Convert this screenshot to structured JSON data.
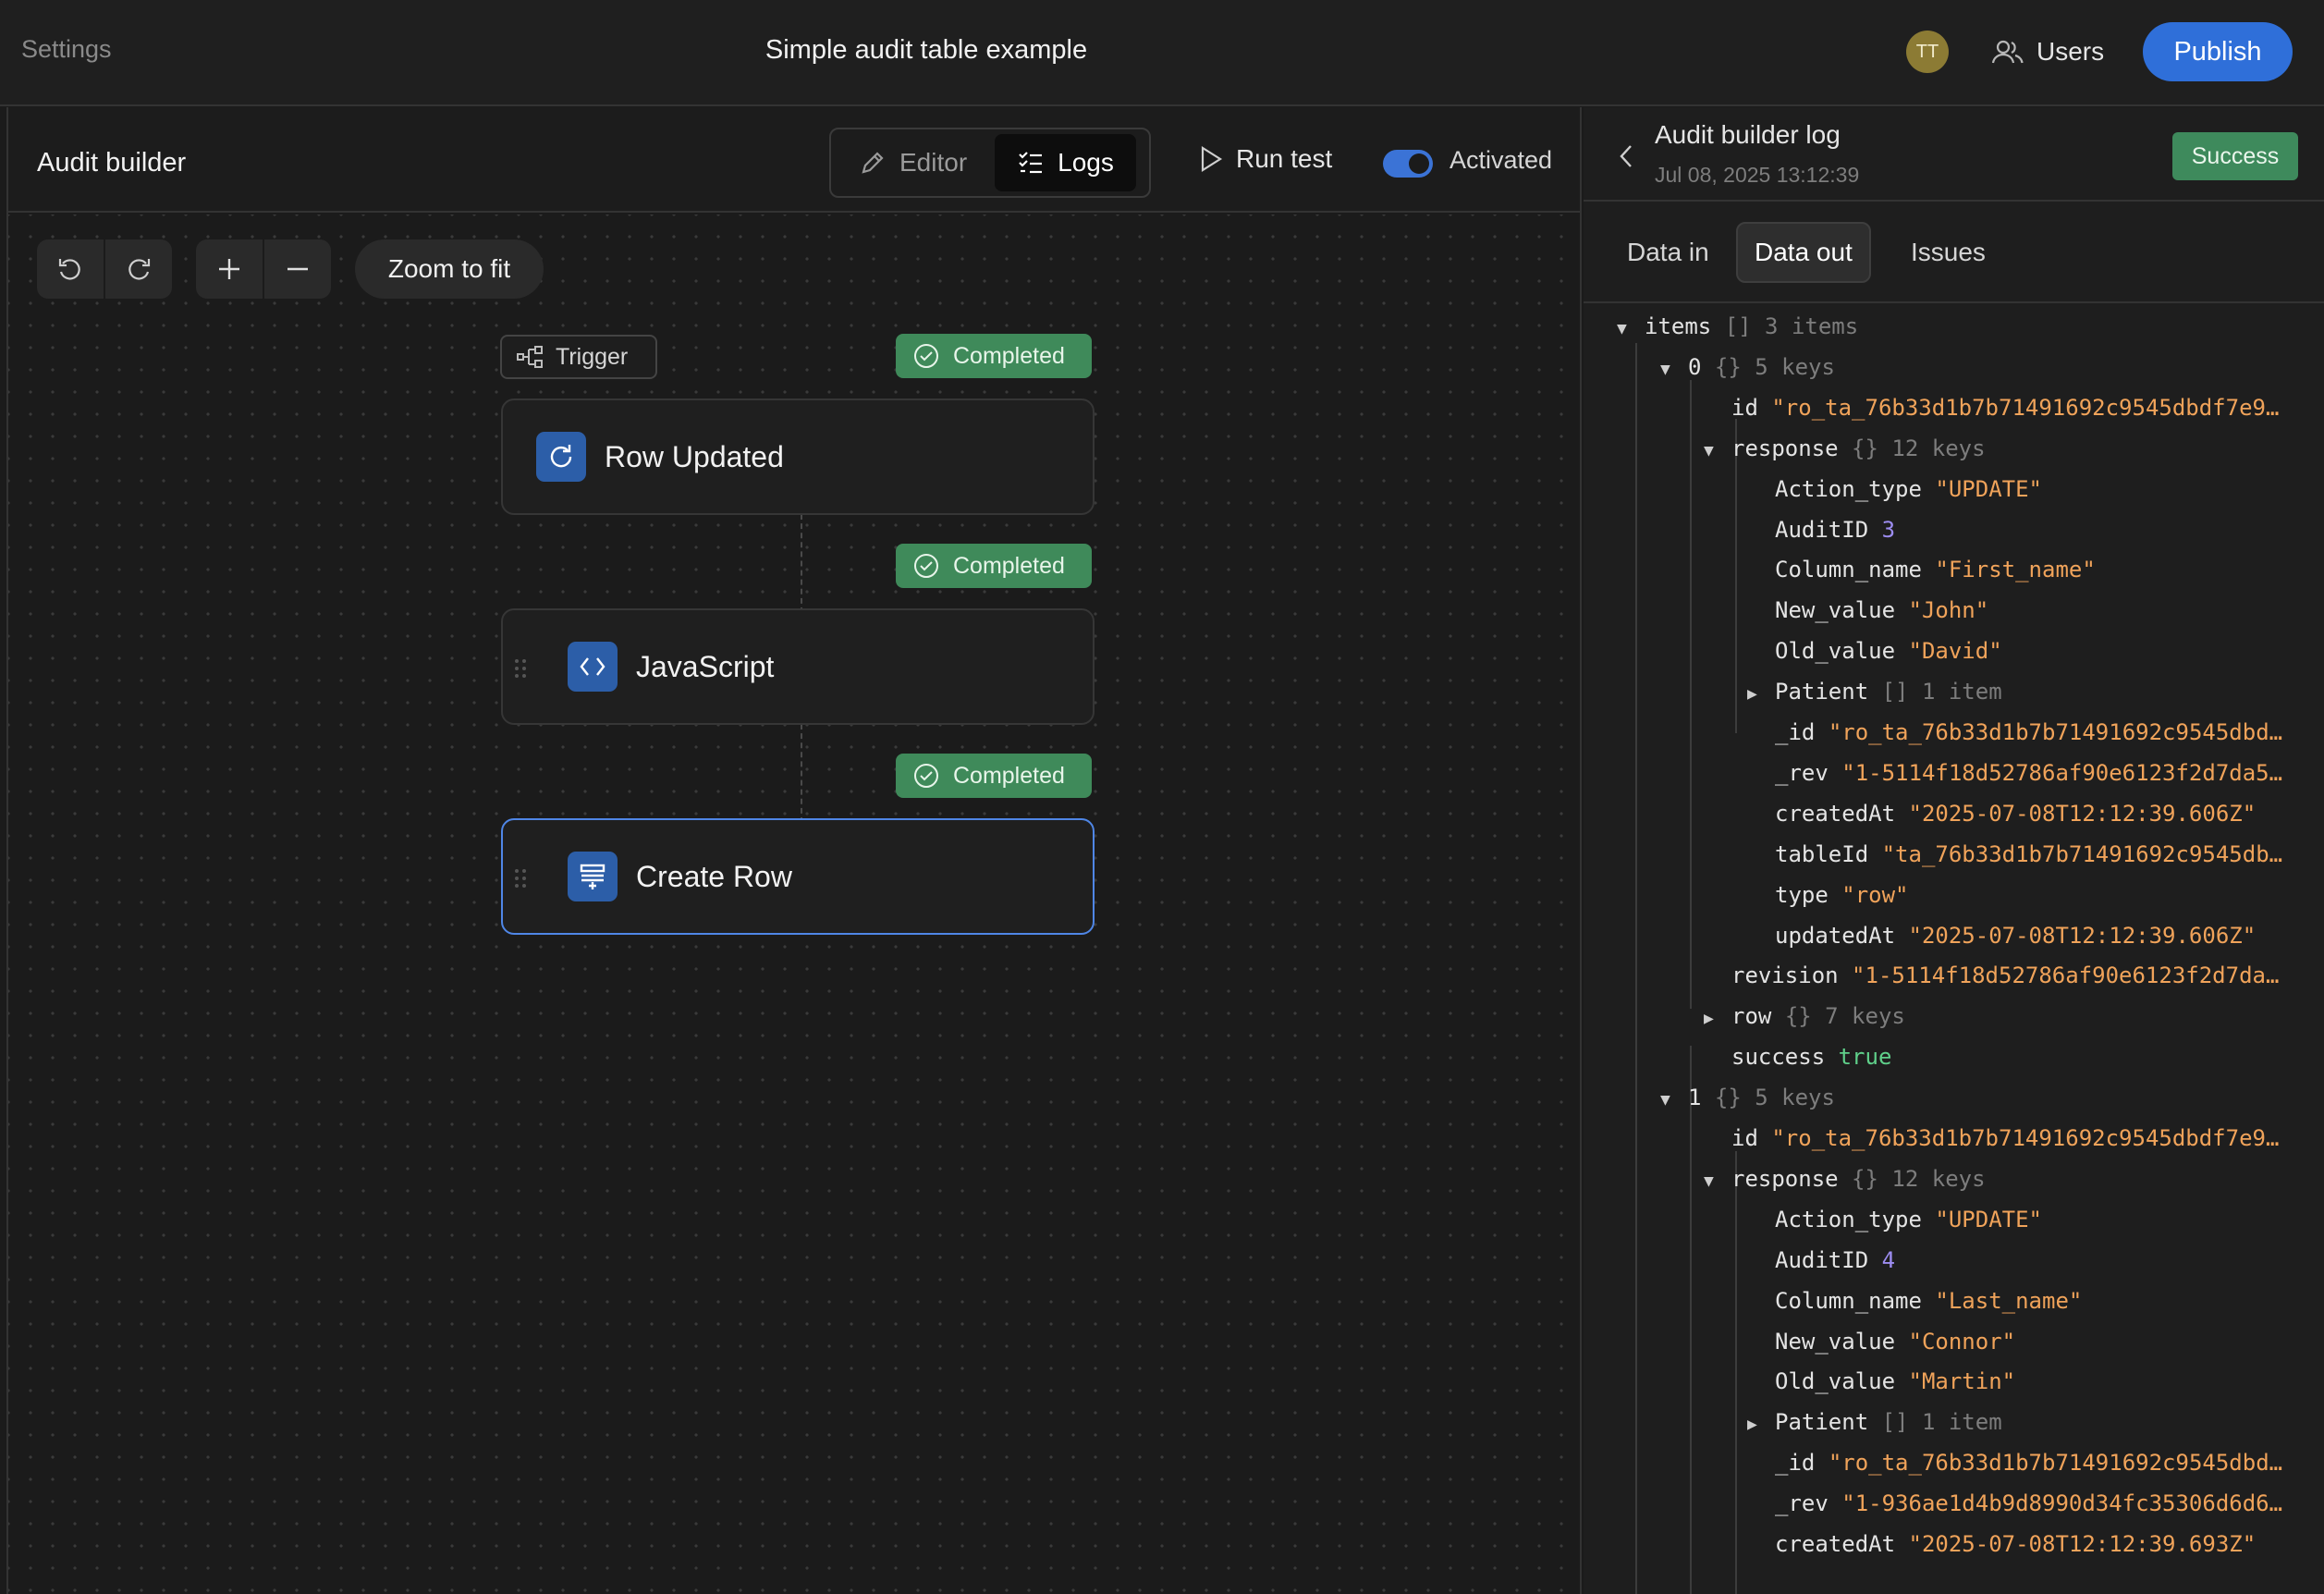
{
  "topbar": {
    "settings_label": "Settings",
    "app_title": "Simple audit table example",
    "avatar_initials": "TT",
    "users_label": "Users",
    "publish_label": "Publish"
  },
  "builder": {
    "title": "Audit builder",
    "tab_editor": "Editor",
    "tab_logs": "Logs",
    "run_test_label": "Run test",
    "activated_label": "Activated",
    "zoom_to_fit_label": "Zoom to fit",
    "trigger_label": "Trigger",
    "status_1": "Completed",
    "status_2": "Completed",
    "status_3": "Completed",
    "node_1": "Row Updated",
    "node_2": "JavaScript",
    "node_3": "Create Row"
  },
  "log": {
    "title": "Audit builder log",
    "date": "Jul 08, 2025 13:12:39",
    "status": "Success",
    "tab_data_in": "Data in",
    "tab_data_out": "Data out",
    "tab_issues": "Issues"
  },
  "tree": [
    {
      "d": 0,
      "ar": "down",
      "k": "items",
      "m": "[] 3 items"
    },
    {
      "d": 1,
      "ar": "down",
      "k": "0",
      "m": "{} 5 keys"
    },
    {
      "d": 2,
      "k": "id",
      "v": "\"ro_ta_76b33d1b7b71491692c9545dbdf7e9…",
      "t": "s"
    },
    {
      "d": 2,
      "ar": "down",
      "k": "response",
      "m": "{} 12 keys"
    },
    {
      "d": 3,
      "k": "Action_type",
      "v": "\"UPDATE\"",
      "t": "s"
    },
    {
      "d": 3,
      "k": "AuditID",
      "v": "3",
      "t": "n"
    },
    {
      "d": 3,
      "k": "Column_name",
      "v": "\"First_name\"",
      "t": "s"
    },
    {
      "d": 3,
      "k": "New_value",
      "v": "\"John\"",
      "t": "s"
    },
    {
      "d": 3,
      "k": "Old_value",
      "v": "\"David\"",
      "t": "s"
    },
    {
      "d": 3,
      "ar": "right",
      "k": "Patient",
      "m": "[] 1 item"
    },
    {
      "d": 3,
      "k": "_id",
      "v": "\"ro_ta_76b33d1b7b71491692c9545dbd…",
      "t": "s"
    },
    {
      "d": 3,
      "k": "_rev",
      "v": "\"1-5114f18d52786af90e6123f2d7da5…",
      "t": "s"
    },
    {
      "d": 3,
      "k": "createdAt",
      "v": "\"2025-07-08T12:12:39.606Z\"",
      "t": "s"
    },
    {
      "d": 3,
      "k": "tableId",
      "v": "\"ta_76b33d1b7b71491692c9545db…",
      "t": "s"
    },
    {
      "d": 3,
      "k": "type",
      "v": "\"row\"",
      "t": "s"
    },
    {
      "d": 3,
      "k": "updatedAt",
      "v": "\"2025-07-08T12:12:39.606Z\"",
      "t": "s"
    },
    {
      "d": 2,
      "k": "revision",
      "v": "\"1-5114f18d52786af90e6123f2d7da…",
      "t": "s"
    },
    {
      "d": 2,
      "ar": "right",
      "k": "row",
      "m": "{} 7 keys"
    },
    {
      "d": 2,
      "k": "success",
      "v": "true",
      "t": "b"
    },
    {
      "d": 1,
      "ar": "down",
      "k": "1",
      "m": "{} 5 keys"
    },
    {
      "d": 2,
      "k": "id",
      "v": "\"ro_ta_76b33d1b7b71491692c9545dbdf7e9…",
      "t": "s"
    },
    {
      "d": 2,
      "ar": "down",
      "k": "response",
      "m": "{} 12 keys"
    },
    {
      "d": 3,
      "k": "Action_type",
      "v": "\"UPDATE\"",
      "t": "s"
    },
    {
      "d": 3,
      "k": "AuditID",
      "v": "4",
      "t": "n"
    },
    {
      "d": 3,
      "k": "Column_name",
      "v": "\"Last_name\"",
      "t": "s"
    },
    {
      "d": 3,
      "k": "New_value",
      "v": "\"Connor\"",
      "t": "s"
    },
    {
      "d": 3,
      "k": "Old_value",
      "v": "\"Martin\"",
      "t": "s"
    },
    {
      "d": 3,
      "ar": "right",
      "k": "Patient",
      "m": "[] 1 item"
    },
    {
      "d": 3,
      "k": "_id",
      "v": "\"ro_ta_76b33d1b7b71491692c9545dbd…",
      "t": "s"
    },
    {
      "d": 3,
      "k": "_rev",
      "v": "\"1-936ae1d4b9d8990d34fc35306d6d6…",
      "t": "s"
    },
    {
      "d": 3,
      "k": "createdAt",
      "v": "\"2025-07-08T12:12:39.693Z\"",
      "t": "s"
    }
  ],
  "colors": {
    "accent": "#2f6fd9",
    "success": "#3e8a5c",
    "string": "#f0a35a",
    "number": "#9d8df1",
    "boolean": "#5fd08a"
  }
}
